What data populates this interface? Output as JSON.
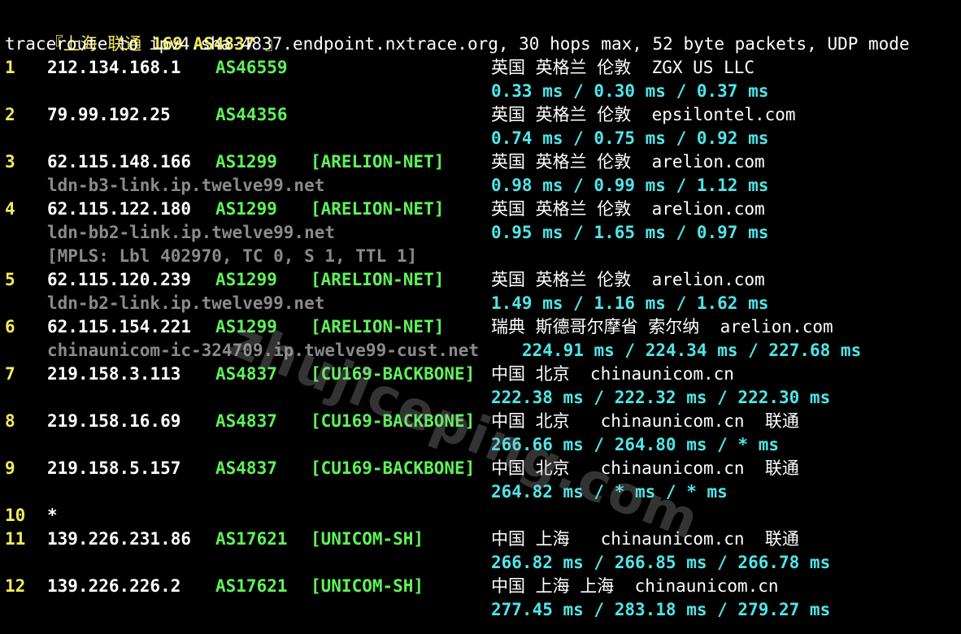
{
  "header": {
    "title_cn": "『上海 联通 ",
    "title_bold": "169 AS4837",
    "title_end": " 』",
    "command_line": "traceroute to ipv4.sha-4837.endpoint.nxtrace.org, 30 hops max, 52 byte packets, UDP mode"
  },
  "watermark": "zhujiceping.com",
  "hops": [
    {
      "hop": "1",
      "ip": "212.134.168.1",
      "asn": "AS46559",
      "tag": "",
      "geo": "英国 英格兰 伦敦  ZGX US LLC",
      "host": "",
      "mpls": "",
      "rtt": "0.33 ms / 0.30 ms / 0.37 ms"
    },
    {
      "hop": "2",
      "ip": "79.99.192.25",
      "asn": "AS44356",
      "tag": "",
      "geo": "英国 英格兰 伦敦  epsilontel.com",
      "host": "",
      "mpls": "",
      "rtt": "0.74 ms / 0.75 ms / 0.92 ms"
    },
    {
      "hop": "3",
      "ip": "62.115.148.166",
      "asn": "AS1299",
      "tag": "[ARELION-NET]",
      "geo": "英国 英格兰 伦敦  arelion.com",
      "host": "ldn-b3-link.ip.twelve99.net",
      "mpls": "",
      "rtt": "0.98 ms / 0.99 ms / 1.12 ms"
    },
    {
      "hop": "4",
      "ip": "62.115.122.180",
      "asn": "AS1299",
      "tag": "[ARELION-NET]",
      "geo": "英国 英格兰 伦敦  arelion.com",
      "host": "ldn-bb2-link.ip.twelve99.net",
      "mpls": "[MPLS: Lbl 402970, TC 0, S 1, TTL 1]",
      "rtt": "0.95 ms / 1.65 ms / 0.97 ms"
    },
    {
      "hop": "5",
      "ip": "62.115.120.239",
      "asn": "AS1299",
      "tag": "[ARELION-NET]",
      "geo": "英国 英格兰 伦敦  arelion.com",
      "host": "ldn-b2-link.ip.twelve99.net",
      "mpls": "",
      "rtt": "1.49 ms / 1.16 ms / 1.62 ms"
    },
    {
      "hop": "6",
      "ip": "62.115.154.221",
      "asn": "AS1299",
      "tag": "[ARELION-NET]",
      "geo": "瑞典 斯德哥尔摩省 索尔纳  arelion.com",
      "host": "chinaunicom-ic-324709.ip.twelve99-cust.net",
      "mpls": "",
      "rtt": "224.91 ms / 224.34 ms / 227.68 ms"
    },
    {
      "hop": "7",
      "ip": "219.158.3.113",
      "asn": "AS4837",
      "tag": "[CU169-BACKBONE]",
      "geo": "中国 北京  chinaunicom.cn",
      "host": "",
      "mpls": "",
      "rtt": "222.38 ms / 222.32 ms / 222.30 ms"
    },
    {
      "hop": "8",
      "ip": "219.158.16.69",
      "asn": "AS4837",
      "tag": "[CU169-BACKBONE]",
      "geo": "中国 北京   chinaunicom.cn  联通",
      "host": "",
      "mpls": "",
      "rtt": "266.66 ms / 264.80 ms / * ms"
    },
    {
      "hop": "9",
      "ip": "219.158.5.157",
      "asn": "AS4837",
      "tag": "[CU169-BACKBONE]",
      "geo": "中国 北京   chinaunicom.cn  联通",
      "host": "",
      "mpls": "",
      "rtt": "264.82 ms / * ms / * ms"
    },
    {
      "hop": "10",
      "ip": "*",
      "asn": "",
      "tag": "",
      "geo": "",
      "host": "",
      "mpls": "",
      "rtt": ""
    },
    {
      "hop": "11",
      "ip": "139.226.231.86",
      "asn": "AS17621",
      "tag": "[UNICOM-SH]",
      "geo": "中国 上海   chinaunicom.cn  联通",
      "host": "",
      "mpls": "",
      "rtt": "266.82 ms / 266.85 ms / 266.78 ms"
    },
    {
      "hop": "12",
      "ip": "139.226.226.2",
      "asn": "AS17621",
      "tag": "[UNICOM-SH]",
      "geo": "中国 上海 上海  chinaunicom.cn",
      "host": "",
      "mpls": "",
      "rtt": "277.45 ms / 283.18 ms / 279.27 ms"
    }
  ]
}
